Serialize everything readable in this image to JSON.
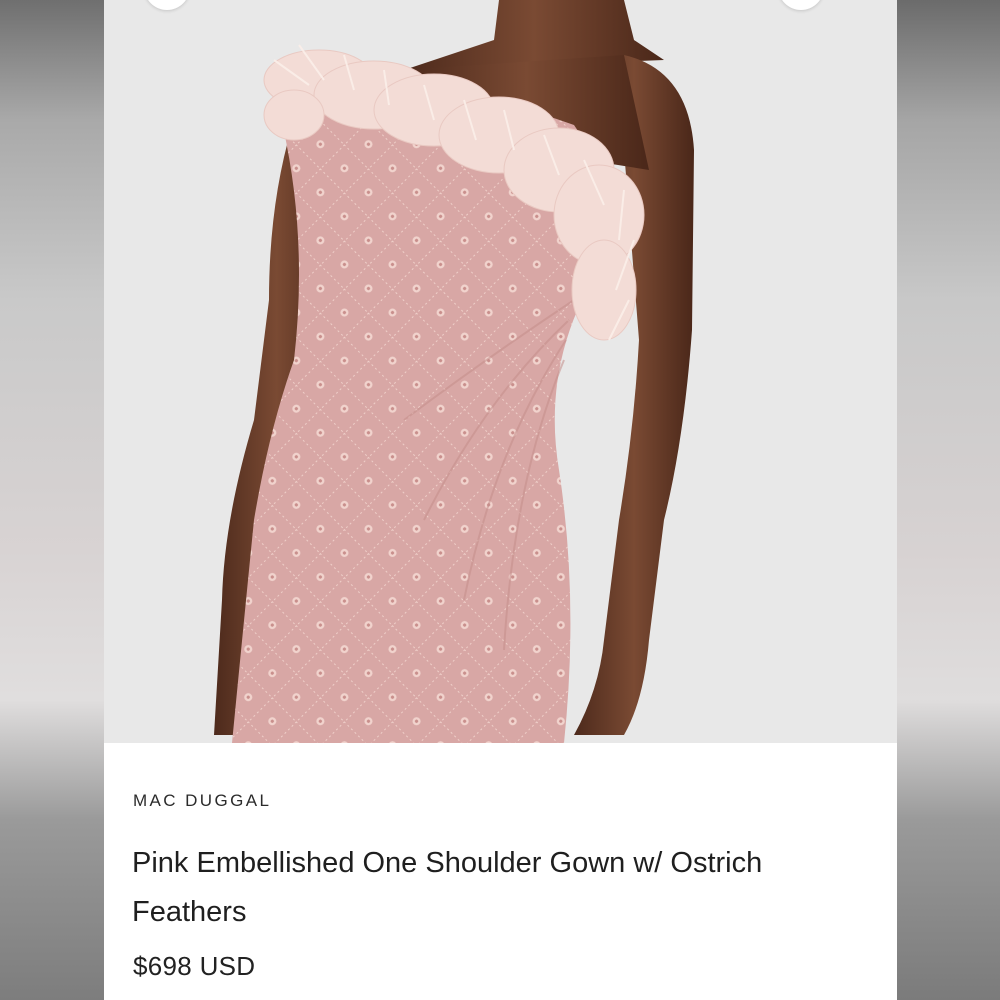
{
  "product": {
    "brand": "MAC DUGGAL",
    "title": "Pink Embellished One Shoulder Gown w/ Ostrich Feathers",
    "price": "$698 USD",
    "image_description_icon": "product-photo"
  },
  "navigation": {
    "prev_icon": "chevron-left-icon",
    "next_icon": "chevron-right-icon"
  },
  "colors": {
    "dress": "#d9a8a8",
    "feathers": "#f2dcd6",
    "skin": "#6b3f2b",
    "photo_background": "#e7e7e7",
    "text": "#1f1f1f"
  }
}
